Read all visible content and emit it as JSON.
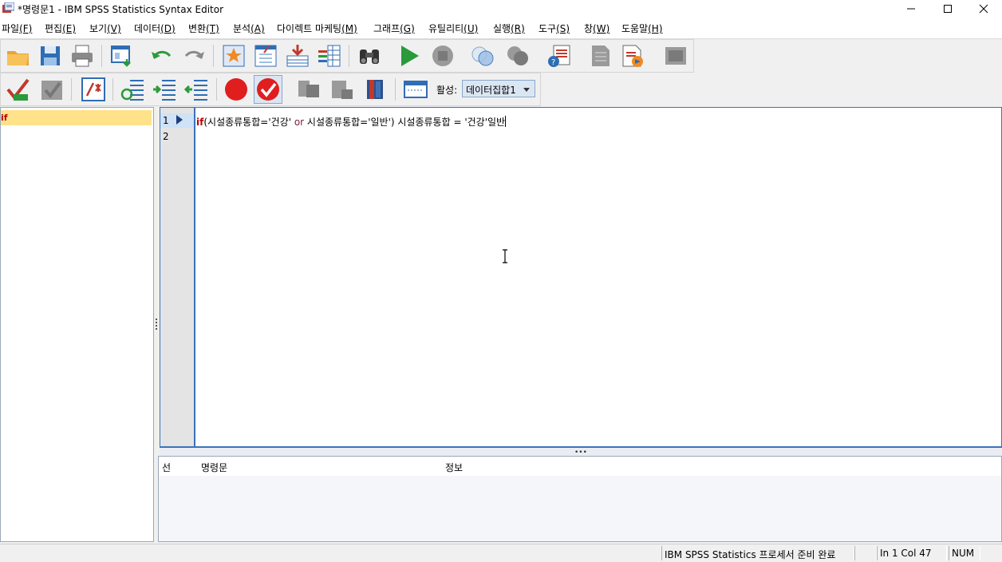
{
  "window": {
    "title": "*명령문1 - IBM SPSS Statistics Syntax Editor",
    "controls": [
      "minimize",
      "maximize",
      "close"
    ]
  },
  "menu": [
    {
      "label": "파일",
      "key": "(F)"
    },
    {
      "label": "편집",
      "key": "(E)"
    },
    {
      "label": "보기",
      "key": "(V)"
    },
    {
      "label": "데이터",
      "key": "(D)"
    },
    {
      "label": "변환",
      "key": "(T)"
    },
    {
      "label": "분석",
      "key": "(A)"
    },
    {
      "label": "다이렉트 마케팅",
      "key": "(M)"
    },
    {
      "label": "그래프",
      "key": "(G)"
    },
    {
      "label": "유틸리티",
      "key": "(U)"
    },
    {
      "label": "실행",
      "key": "(R)"
    },
    {
      "label": "도구",
      "key": "(S)"
    },
    {
      "label": "창",
      "key": "(W)"
    },
    {
      "label": "도움말",
      "key": "(H)"
    }
  ],
  "toolbar": {
    "active_label": "활성:",
    "active_dataset": "데이터집합1",
    "icons": [
      "open-folder-icon",
      "save-icon",
      "print-icon",
      "dialog-recall-icon",
      "undo-icon",
      "redo-icon",
      "goto-case-icon",
      "goto-variable-icon",
      "insert-cases-icon",
      "variables-icon",
      "find-icon",
      "run-icon",
      "stop-icon",
      "toggle-icon",
      "stop-processor-icon",
      "syntax-help-icon",
      "comment-icon",
      "bookmark-icon"
    ]
  },
  "navigator": {
    "items": [
      "if"
    ]
  },
  "editor": {
    "line_numbers": [
      "1",
      "2"
    ],
    "code": {
      "kw_if": "if",
      "part1": "(시설종류통합='건강' ",
      "kw_or": "or",
      "part2": " 시설종류통합='일반') 시설종류통합 =  '건강'일반"
    }
  },
  "error_pane": {
    "columns": [
      "선",
      "명령문",
      "정보"
    ]
  },
  "status": {
    "processor": "IBM SPSS Statistics 프로세서 준비 완료",
    "position": "In 1 Col 47",
    "num": "NUM"
  }
}
